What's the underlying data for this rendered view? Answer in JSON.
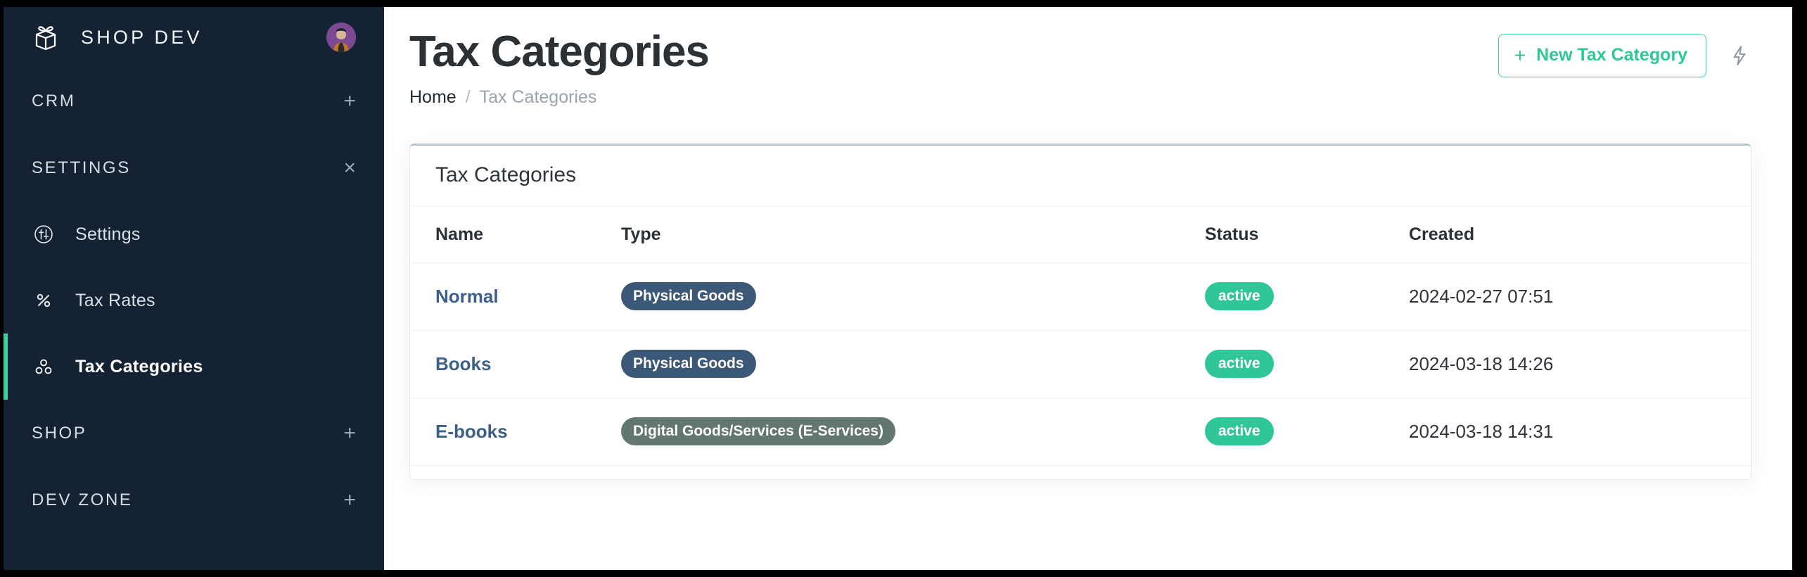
{
  "brand": {
    "name": "SHOP DEV",
    "logo_icon": "gift-box-icon",
    "avatar_icon": "user-avatar"
  },
  "sidebar": {
    "sections": [
      {
        "label": "CRM",
        "toggle": "+",
        "toggle_icon": "plus-icon"
      },
      {
        "label": "SETTINGS",
        "toggle": "×",
        "toggle_icon": "close-icon"
      }
    ],
    "items": [
      {
        "label": "Settings",
        "icon": "sliders-circle-icon",
        "active": false
      },
      {
        "label": "Tax Rates",
        "icon": "percent-icon",
        "active": false
      },
      {
        "label": "Tax Categories",
        "icon": "three-circles-icon",
        "active": true
      }
    ],
    "sections_bottom": [
      {
        "label": "SHOP",
        "toggle": "+",
        "toggle_icon": "plus-icon"
      },
      {
        "label": "DEV ZONE",
        "toggle": "+",
        "toggle_icon": "plus-icon"
      }
    ]
  },
  "header": {
    "title": "Tax Categories",
    "breadcrumb": {
      "home": "Home",
      "separator": "/",
      "current": "Tax Categories"
    },
    "new_button": {
      "plus": "+",
      "label": "New Tax Category"
    },
    "bolt_icon": "lightning-bolt-icon"
  },
  "card": {
    "title": "Tax Categories",
    "columns": [
      "Name",
      "Type",
      "Status",
      "Created"
    ],
    "rows": [
      {
        "name": "Normal",
        "type": "Physical Goods",
        "type_style": "physical",
        "status": "active",
        "created": "2024-02-27 07:51"
      },
      {
        "name": "Books",
        "type": "Physical Goods",
        "type_style": "physical",
        "status": "active",
        "created": "2024-03-18 14:26"
      },
      {
        "name": "E-books",
        "type": "Digital Goods/Services (E-Services)",
        "type_style": "digital",
        "status": "active",
        "created": "2024-03-18 14:31"
      }
    ]
  },
  "colors": {
    "sidebar_bg": "#152234",
    "accent_teal": "#3ad29f",
    "badge_physical": "#3c5878",
    "badge_digital": "#61776f",
    "badge_active": "#2fc79a",
    "link_blue": "#3d6089",
    "title_dark": "#2c3136"
  }
}
